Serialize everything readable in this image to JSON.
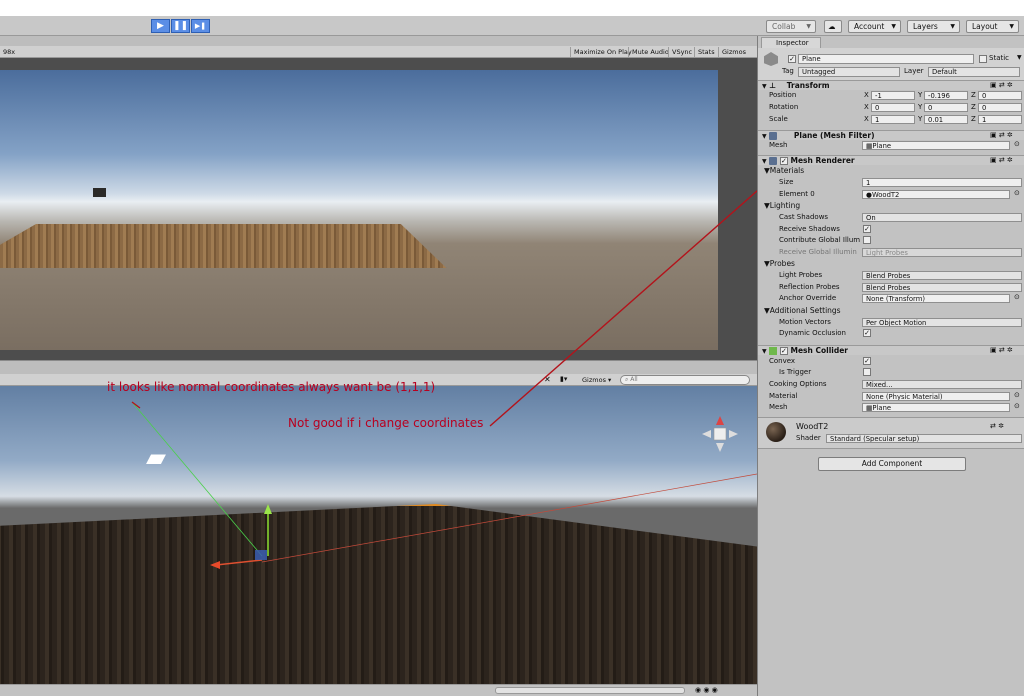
{
  "toolbar": {
    "collab": "Collab",
    "account": "Account",
    "layers": "Layers",
    "layout": "Layout",
    "play": "▶",
    "pause": "❚❚",
    "step": "▶❚"
  },
  "game": {
    "scale_fragment": "98x",
    "options": [
      "Maximize On Play",
      "Mute Audio",
      "VSync",
      "Stats",
      "Gizmos"
    ]
  },
  "scene": {
    "gizmos": "Gizmos",
    "search_placeholder": "All"
  },
  "annotations": {
    "note1": "it looks like normal coordinates always want be (1,1,1)",
    "note2": "Not good if i change coordinates"
  },
  "inspector": {
    "tab": "Inspector",
    "object_name": "Plane",
    "static_label": "Static",
    "tag_label": "Tag",
    "tag_value": "Untagged",
    "layer_label": "Layer",
    "layer_value": "Default",
    "transform": {
      "title": "Transform",
      "position": {
        "label": "Position",
        "x": "-1",
        "y": "-0.196",
        "z": "0"
      },
      "rotation": {
        "label": "Rotation",
        "x": "0",
        "y": "0",
        "z": "0"
      },
      "scale": {
        "label": "Scale",
        "x": "1",
        "y": "0.01",
        "z": "1"
      }
    },
    "mesh_filter": {
      "title": "Plane (Mesh Filter)",
      "mesh_label": "Mesh",
      "mesh_value": "Plane"
    },
    "mesh_renderer": {
      "title": "Mesh Renderer",
      "materials": "Materials",
      "size_label": "Size",
      "size_value": "1",
      "element_label": "Element 0",
      "element_value": "WoodT2",
      "lighting": "Lighting",
      "cast_label": "Cast Shadows",
      "cast_value": "On",
      "receive_label": "Receive Shadows",
      "contrib_label": "Contribute Global Illum",
      "rgi_label": "Receive Global Illumin",
      "rgi_value": "Light Probes",
      "probes": "Probes",
      "light_probes_label": "Light Probes",
      "light_probes_value": "Blend Probes",
      "refl_label": "Reflection Probes",
      "refl_value": "Blend Probes",
      "anchor_label": "Anchor Override",
      "anchor_value": "None (Transform)",
      "additional": "Additional Settings",
      "motion_label": "Motion Vectors",
      "motion_value": "Per Object Motion",
      "dyn_label": "Dynamic Occlusion"
    },
    "mesh_collider": {
      "title": "Mesh Collider",
      "convex_label": "Convex",
      "trigger_label": "Is Trigger",
      "cooking_label": "Cooking Options",
      "cooking_value": "Mixed...",
      "material_label": "Material",
      "material_value": "None (Physic Material)",
      "mesh_label": "Mesh",
      "mesh_value": "Plane"
    },
    "material": {
      "name": "WoodT2",
      "shader_label": "Shader",
      "shader_value": "Standard (Specular setup)"
    },
    "add_component": "Add Component",
    "axis_x": "X",
    "axis_y": "Y",
    "axis_z": "Z"
  }
}
